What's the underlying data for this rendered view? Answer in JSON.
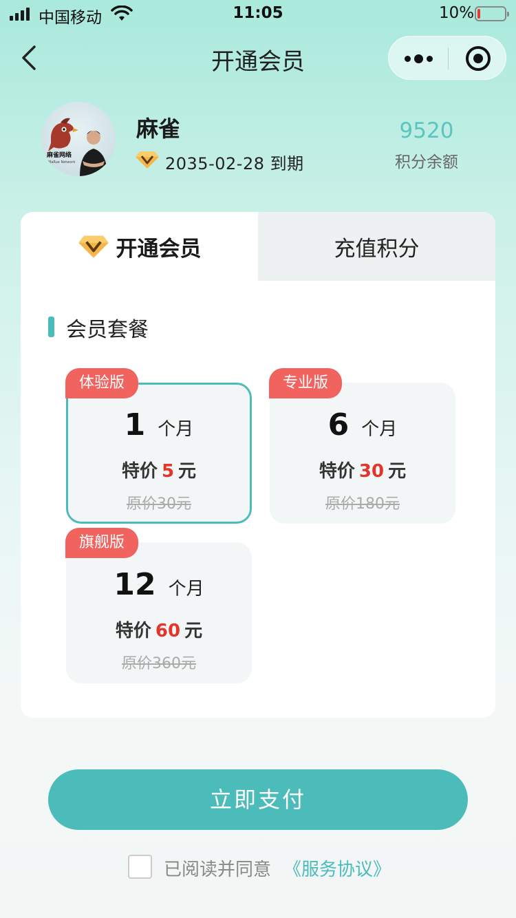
{
  "status_bar": {
    "carrier": "中国移动",
    "time": "11:05",
    "battery_percent": "10%",
    "battery_level": 0.1,
    "icons": [
      "signal-icon",
      "wifi-icon",
      "battery-icon"
    ]
  },
  "nav": {
    "title": "开通会员",
    "icons": [
      "back-arrow-icon",
      "more-dots-icon",
      "close-target-icon"
    ]
  },
  "profile": {
    "name": "麻雀",
    "expiry": "2035-02-28 到期",
    "points_value": "9520",
    "points_label": "积分余额",
    "avatar_logo_text": "麻雀网络",
    "avatar_logo_subtext": "MaRue Network"
  },
  "tabs": {
    "active": "开通会员",
    "inactive": "充值积分"
  },
  "section": {
    "title": "会员套餐"
  },
  "plans": [
    {
      "badge": "体验版",
      "num": "1",
      "unit": "个月",
      "price_prefix": "特价",
      "price": "5",
      "price_suffix": "元",
      "original": "原价30元",
      "selected": true
    },
    {
      "badge": "专业版",
      "num": "6",
      "unit": "个月",
      "price_prefix": "特价",
      "price": "30",
      "price_suffix": "元",
      "original": "原价180元",
      "selected": false
    },
    {
      "badge": "旗舰版",
      "num": "12",
      "unit": "个月",
      "price_prefix": "特价",
      "price": "60",
      "price_suffix": "元",
      "original": "原价360元",
      "selected": false
    }
  ],
  "pay": {
    "button": "立即支付",
    "agree_text": "已阅读并同意",
    "agree_link": "《服务协议》",
    "agreed": false
  },
  "colors": {
    "accent": "#4cbcbb",
    "badge": "#f0635f",
    "price_highlight": "#e3352a",
    "battery_low": "#e53935"
  }
}
